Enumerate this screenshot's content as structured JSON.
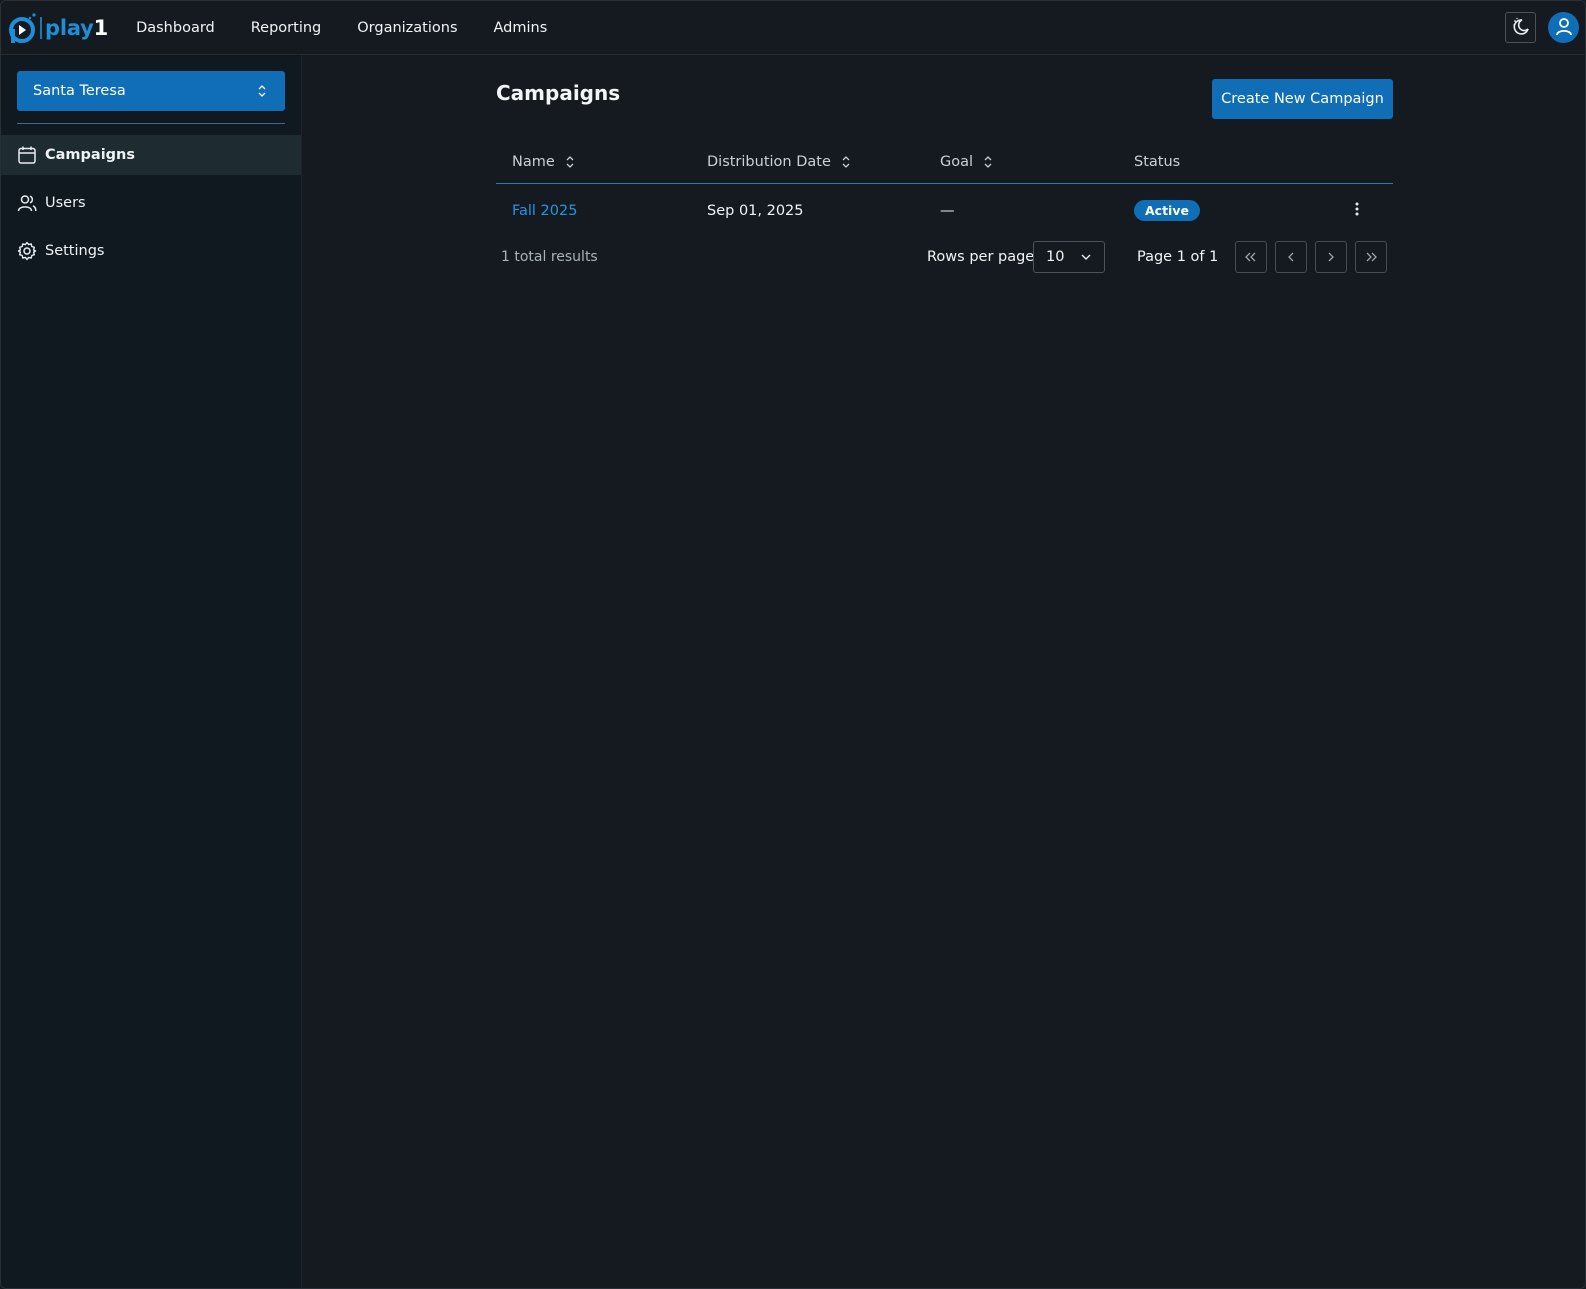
{
  "header": {
    "logo_text_main": "play",
    "logo_text_suffix": "1",
    "nav": [
      "Dashboard",
      "Reporting",
      "Organizations",
      "Admins"
    ]
  },
  "sidebar": {
    "org_selected": "Santa Teresa",
    "items": [
      {
        "label": "Campaigns",
        "icon": "calendar-icon",
        "active": true
      },
      {
        "label": "Users",
        "icon": "users-icon",
        "active": false
      },
      {
        "label": "Settings",
        "icon": "gear-icon",
        "active": false
      }
    ]
  },
  "main": {
    "title": "Campaigns",
    "create_button": "Create New Campaign",
    "table": {
      "columns": [
        "Name",
        "Distribution Date",
        "Goal",
        "Status"
      ],
      "rows": [
        {
          "name": "Fall 2025",
          "distribution_date": "Sep 01, 2025",
          "goal": "—",
          "status": "Active"
        }
      ]
    },
    "footer": {
      "total": "1 total results",
      "rows_per_page_label": "Rows per page",
      "rows_per_page_value": "10",
      "page_info": "Page 1 of 1"
    }
  },
  "colors": {
    "background": "#141a1f",
    "sidebar": "#101920",
    "accent": "#0f6eb6",
    "link": "#2196e4"
  }
}
